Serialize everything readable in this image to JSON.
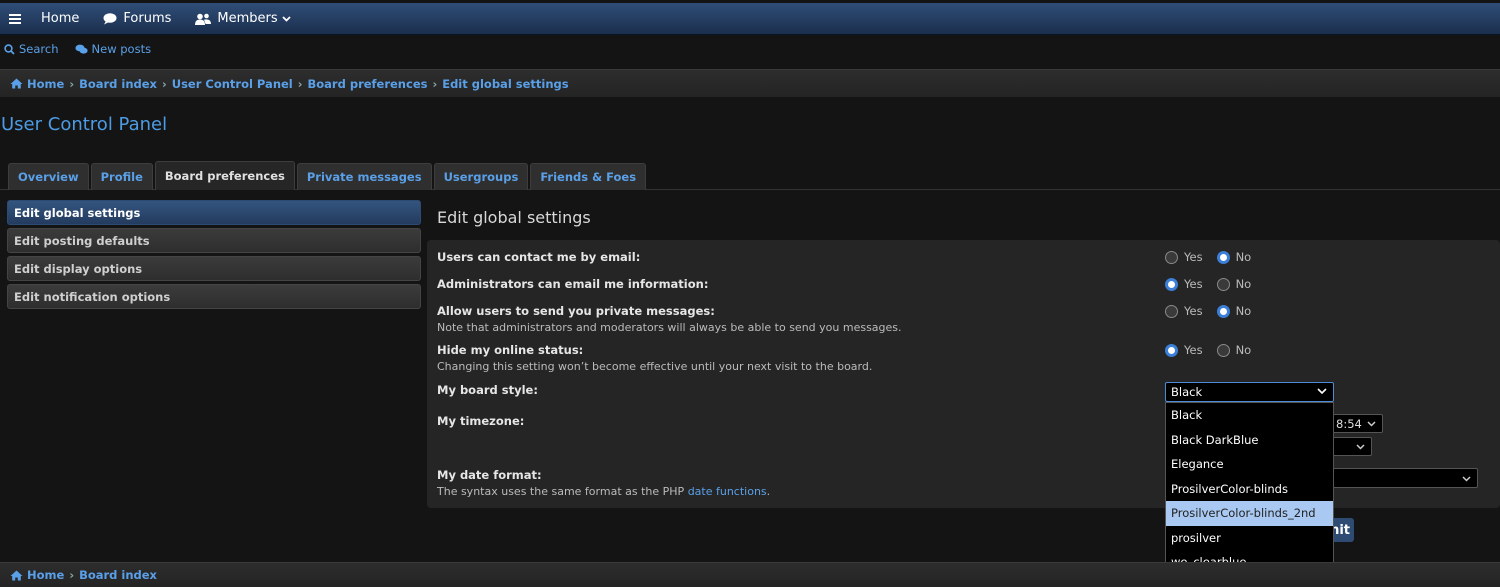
{
  "nav": {
    "home": "Home",
    "forums": "Forums",
    "members": "Members"
  },
  "quicklinks": {
    "search": "Search",
    "new_posts": "New posts"
  },
  "breadcrumb_top": [
    "Home",
    "Board index",
    "User Control Panel",
    "Board preferences",
    "Edit global settings"
  ],
  "breadcrumb_bottom": [
    "Home",
    "Board index"
  ],
  "page_title": "User Control Panel",
  "tabs": [
    "Overview",
    "Profile",
    "Board preferences",
    "Private messages",
    "Usergroups",
    "Friends & Foes"
  ],
  "active_tab": "Board preferences",
  "sidemenu": [
    "Edit global settings",
    "Edit posting defaults",
    "Edit display options",
    "Edit notification options"
  ],
  "panel_title": "Edit global settings",
  "settings": [
    {
      "label": "Users can contact me by email:",
      "value": "No"
    },
    {
      "label": "Administrators can email me information:",
      "value": "Yes"
    },
    {
      "label": "Allow users to send you private messages:",
      "desc": "Note that administrators and moderators will always be able to send you messages.",
      "value": "No"
    },
    {
      "label": "Hide my online status:",
      "desc": "Changing this setting won’t become effective until your next visit to the board.",
      "value": "Yes"
    },
    {
      "label": "My board style:"
    },
    {
      "label": "My timezone:"
    },
    {
      "label": "My date format:",
      "desc_prefix": "The syntax uses the same format as the PHP ",
      "desc_link": "date functions",
      "desc_suffix": "."
    }
  ],
  "radio_labels": {
    "yes": "Yes",
    "no": "No"
  },
  "board_style": {
    "selected": "Black",
    "options": [
      "Black",
      "Black DarkBlue",
      "Elegance",
      "ProsilverColor-blinds",
      "ProsilverColor-blinds_2nd",
      "prosilver",
      "we_clearblue"
    ],
    "highlighted": "ProsilverColor-blinds_2nd"
  },
  "timezone_partial": "8:54",
  "submit_partial": "nit",
  "colors": {
    "accent": "#5aa0e8",
    "nav": "#2f4e78",
    "highlight": "#a9c9f2"
  }
}
